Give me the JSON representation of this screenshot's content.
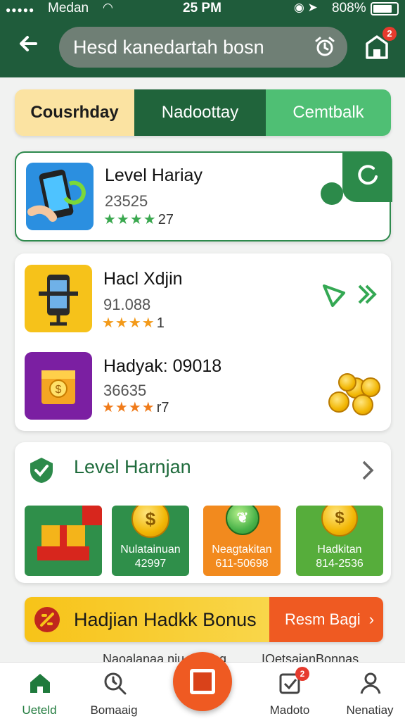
{
  "status_bar": {
    "carrier": "Medan",
    "time": "25 PM",
    "battery": "808%"
  },
  "header": {
    "search_text": "Hesd kanedartah bosn",
    "notification_count": "2"
  },
  "tabs": [
    {
      "label": "Cousrhday"
    },
    {
      "label": "Nadoottay"
    },
    {
      "label": "Cemtbalk"
    }
  ],
  "featured": {
    "title": "Level Hariay",
    "value": "23525",
    "stars": "★★★★",
    "rating_suffix": "27"
  },
  "list_items": [
    {
      "title": "Hacl Xdjin",
      "value": "91.088",
      "stars": "★★★★",
      "rating_suffix": "1"
    },
    {
      "title": "Hadyak: 09018",
      "value": "36635",
      "stars": "★★★★",
      "rating_suffix": "r7"
    }
  ],
  "level_section": {
    "title": "Level Harnjan",
    "tiles": [
      {
        "label": "",
        "value": "",
        "color": "#2f8f4a"
      },
      {
        "label": "Nulatainuan",
        "value": "42997",
        "color": "#2f8f4a"
      },
      {
        "label": "Neagtakitan",
        "value": "611-50698",
        "color": "#f28a1e"
      },
      {
        "label": "Hadkitan",
        "value": "814-2536",
        "color": "#56ad3b"
      }
    ]
  },
  "bonus_banner": {
    "title": "Hadjian Hadkk Bonus",
    "action": "Resm Bagi"
  },
  "peek_row": {
    "left": "Naoalanaa niu",
    "middle": "rng",
    "right": "IOetsaianBonnas"
  },
  "bottom_nav": [
    {
      "label": "Ueteld",
      "icon": "home-icon",
      "active": true
    },
    {
      "label": "Bomaaig",
      "icon": "search-clock-icon"
    },
    {
      "label": "Madoto",
      "icon": "check-box-icon",
      "badge": "2"
    },
    {
      "label": "Nenatiay",
      "icon": "user-icon"
    }
  ],
  "colors": {
    "primary": "#1f5c3b",
    "accent_green": "#2c8a4a",
    "orange": "#ef5a22",
    "yellow": "#f7c318"
  }
}
